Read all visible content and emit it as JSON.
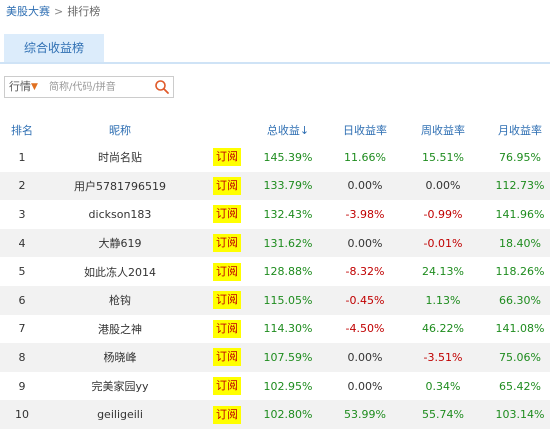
{
  "breadcrumb": {
    "home": "美股大赛",
    "separator": ">",
    "current": "排行榜"
  },
  "tabs": [
    {
      "label": "综合收益榜"
    }
  ],
  "search": {
    "filter_label": "行情",
    "placeholder": "简称/代码/拼音"
  },
  "colors": {
    "accent": "#2f6fb3",
    "positive": "#1e8c1e",
    "negative": "#c00000",
    "neutral": "#333333",
    "subscribe_bg": "#ffff00"
  },
  "table": {
    "headers": {
      "rank": "排名",
      "nickname": "昵称",
      "total": "总收益↓",
      "day": "日收益率",
      "week": "周收益率",
      "month": "月收益率"
    },
    "subscribe_label": "订阅",
    "rows": [
      {
        "rank": "1",
        "name": "时尚名贴",
        "total": "145.39%",
        "day": "11.66%",
        "week": "15.51%",
        "month": "76.95%"
      },
      {
        "rank": "2",
        "name": "用户5781796519",
        "total": "133.79%",
        "day": "0.00%",
        "week": "0.00%",
        "month": "112.73%"
      },
      {
        "rank": "3",
        "name": "dickson183",
        "total": "132.43%",
        "day": "-3.98%",
        "week": "-0.99%",
        "month": "141.96%"
      },
      {
        "rank": "4",
        "name": "大静619",
        "total": "131.62%",
        "day": "0.00%",
        "week": "-0.01%",
        "month": "18.40%"
      },
      {
        "rank": "5",
        "name": "如此冻人2014",
        "total": "128.88%",
        "day": "-8.32%",
        "week": "24.13%",
        "month": "118.26%"
      },
      {
        "rank": "6",
        "name": "枪钩",
        "total": "115.05%",
        "day": "-0.45%",
        "week": "1.13%",
        "month": "66.30%"
      },
      {
        "rank": "7",
        "name": "港股之神",
        "total": "114.30%",
        "day": "-4.50%",
        "week": "46.22%",
        "month": "141.08%"
      },
      {
        "rank": "8",
        "name": "杨晓峰",
        "total": "107.59%",
        "day": "0.00%",
        "week": "-3.51%",
        "month": "75.06%"
      },
      {
        "rank": "9",
        "name": "完美家园yy",
        "total": "102.95%",
        "day": "0.00%",
        "week": "0.34%",
        "month": "65.42%"
      },
      {
        "rank": "10",
        "name": "geiligeili",
        "total": "102.80%",
        "day": "53.99%",
        "week": "55.74%",
        "month": "103.14%"
      }
    ]
  }
}
